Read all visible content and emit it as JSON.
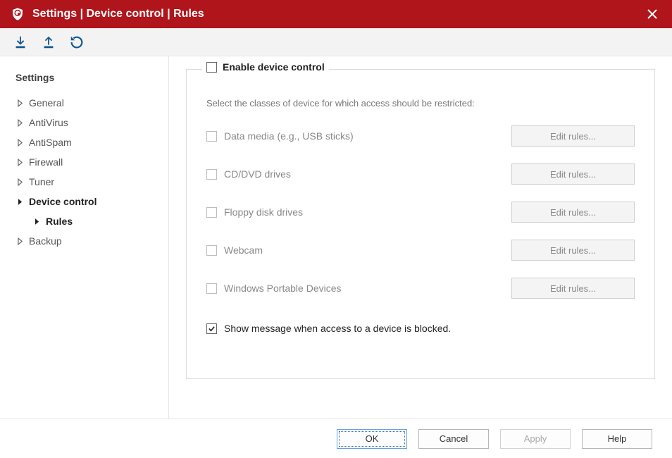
{
  "titlebar": {
    "title": "Settings | Device control | Rules"
  },
  "toolbar": {
    "import_tooltip": "Import",
    "export_tooltip": "Export",
    "reset_tooltip": "Reset"
  },
  "sidebar": {
    "heading": "Settings",
    "items": [
      {
        "label": "General",
        "active": false
      },
      {
        "label": "AntiVirus",
        "active": false
      },
      {
        "label": "AntiSpam",
        "active": false
      },
      {
        "label": "Firewall",
        "active": false
      },
      {
        "label": "Tuner",
        "active": false
      },
      {
        "label": "Device control",
        "active": true,
        "children": [
          {
            "label": "Rules",
            "active": true
          }
        ]
      },
      {
        "label": "Backup",
        "active": false
      }
    ]
  },
  "group": {
    "legend_label": "Enable device control",
    "legend_checked": false,
    "description": "Select the classes of device for which access should be restricted:",
    "devices": [
      {
        "label": "Data media (e.g., USB sticks)",
        "checked": false,
        "button": "Edit rules..."
      },
      {
        "label": "CD/DVD drives",
        "checked": false,
        "button": "Edit rules..."
      },
      {
        "label": "Floppy disk drives",
        "checked": false,
        "button": "Edit rules..."
      },
      {
        "label": "Webcam",
        "checked": false,
        "button": "Edit rules..."
      },
      {
        "label": "Windows Portable Devices",
        "checked": false,
        "button": "Edit rules..."
      }
    ],
    "show_message_label": "Show message when access to a device is blocked.",
    "show_message_checked": true
  },
  "footer": {
    "ok": "OK",
    "cancel": "Cancel",
    "apply": "Apply",
    "help": "Help"
  }
}
